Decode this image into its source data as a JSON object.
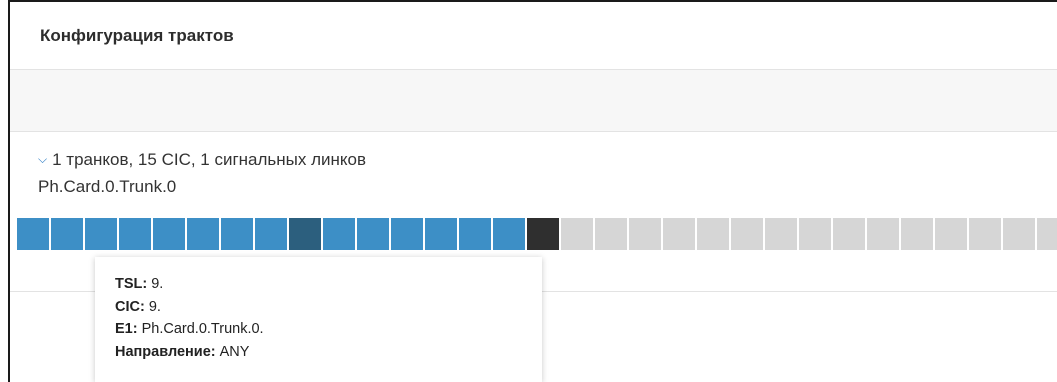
{
  "header": {
    "title": "Конфигурация трактов"
  },
  "trunk_panel": {
    "summary": "1 транков, 15 CIC, 1 сигнальных линков",
    "trunk_name": "Ph.Card.0.Trunk.0",
    "expand_icon": "chevron-down-icon",
    "slot_states": [
      "used",
      "used",
      "used",
      "used",
      "used",
      "used",
      "used",
      "used",
      "hover",
      "used",
      "used",
      "used",
      "used",
      "used",
      "used",
      "signal",
      "empty",
      "empty",
      "empty",
      "empty",
      "empty",
      "empty",
      "empty",
      "empty",
      "empty",
      "empty",
      "empty",
      "empty",
      "empty",
      "empty",
      "empty"
    ],
    "colors": {
      "used": "#3d8fc6",
      "hover": "#2c5f7e",
      "signal": "#2f2f2f",
      "empty": "#d6d6d6"
    }
  },
  "tooltip": {
    "tsl_label": "TSL:",
    "tsl_value": " 9.",
    "cic_label": "CIC:",
    "cic_value": " 9.",
    "e1_label": "E1:",
    "e1_value": " Ph.Card.0.Trunk.0.",
    "dir_label": "Направление:",
    "dir_value": " ANY"
  }
}
